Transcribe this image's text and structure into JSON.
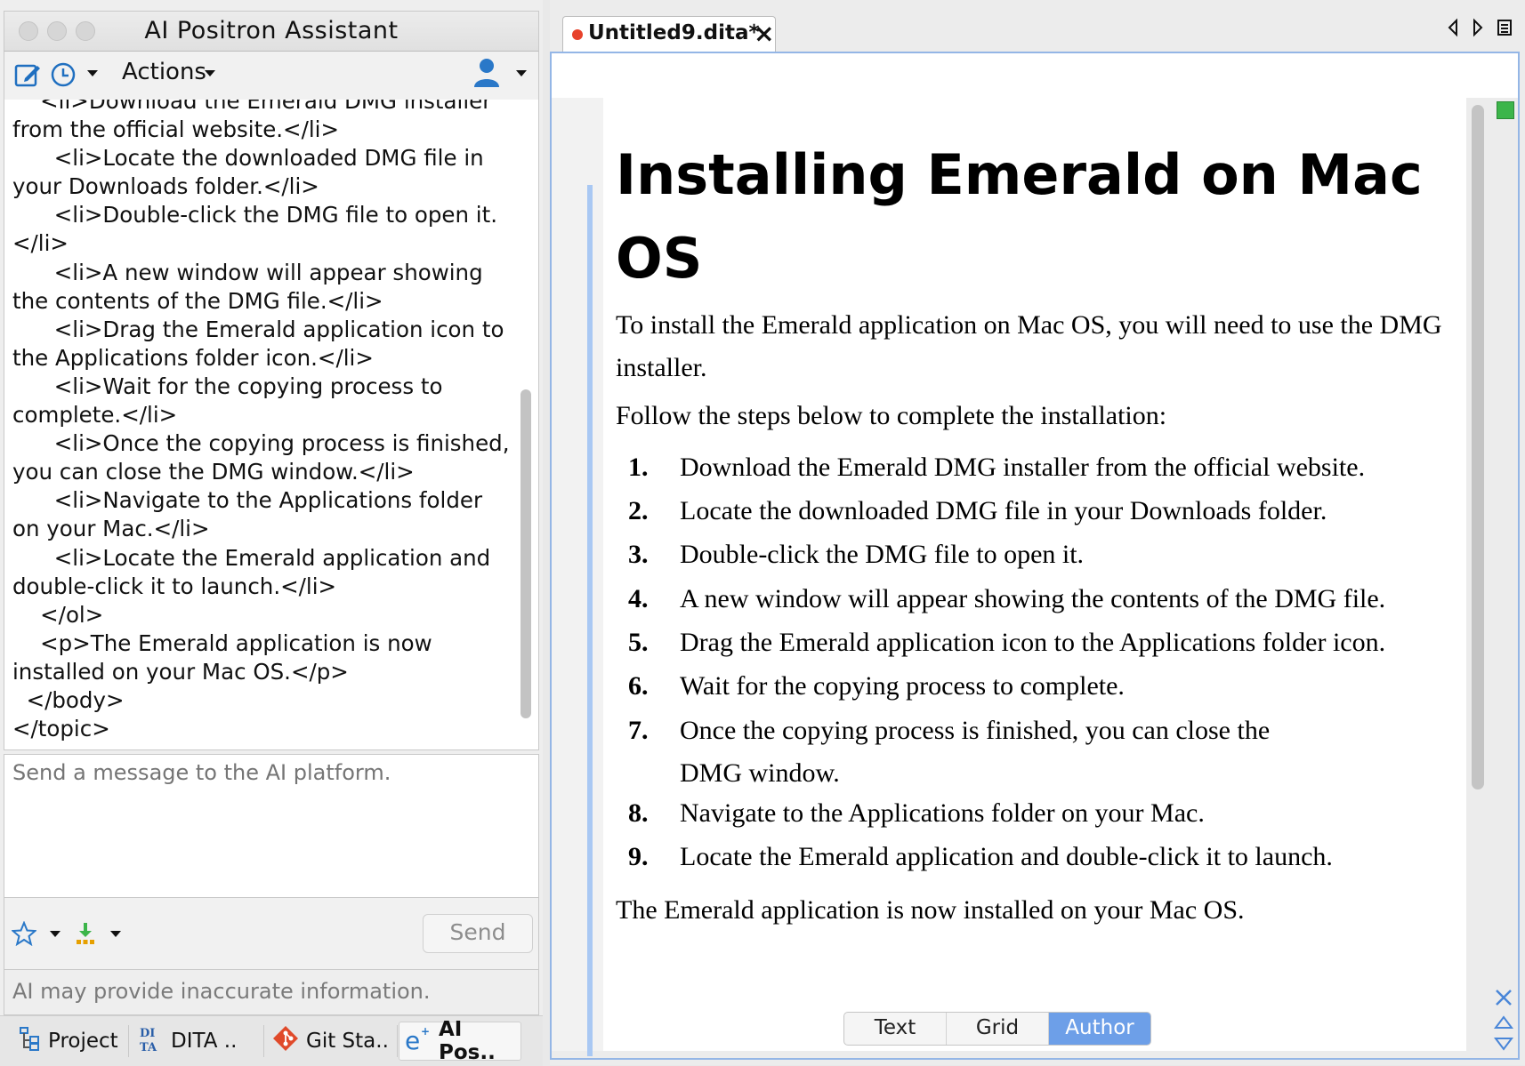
{
  "assistant": {
    "title": "AI Positron Assistant",
    "actions_label": "Actions",
    "chat_code": "    <li>Download the Emerald DMG installer from the official website.</li>\n      <li>Locate the downloaded DMG file in your Downloads folder.</li>\n      <li>Double-click the DMG file to open it.</li>\n      <li>A new window will appear showing the contents of the DMG file.</li>\n      <li>Drag the Emerald application icon to the Applications folder icon.</li>\n      <li>Wait for the copying process to complete.</li>\n      <li>Once the copying process is finished, you can close the DMG window.</li>\n      <li>Navigate to the Applications folder on your Mac.</li>\n      <li>Locate the Emerald application and double-click it to launch.</li>\n    </ol>\n    <p>The Emerald application is now installed on your Mac OS.</p>\n  </body>\n</topic>",
    "input_placeholder": "Send a message to the AI platform.",
    "send_label": "Send",
    "disclaimer": "AI may provide inaccurate information."
  },
  "side_tabs": [
    {
      "label": "Project",
      "icon": "project-icon"
    },
    {
      "label": "DITA ..",
      "icon": "dita-icon"
    },
    {
      "label": "Git Sta..",
      "icon": "git-icon"
    },
    {
      "label": "AI Pos..",
      "icon": "ai-positron-icon"
    }
  ],
  "editor": {
    "tab_title": "Untitled9.dita*",
    "doc_title": "Installing Emerald on Mac OS",
    "intro": "To install the Emerald application on Mac OS, you will need to use the DMG installer.",
    "follow": "Follow the steps below to complete the installation:",
    "steps": [
      "Download the Emerald DMG installer from the official website.",
      "Locate the downloaded DMG file in your Downloads folder.",
      "Double-click the DMG file to open it.",
      "A new window will appear showing the contents of the DMG file.",
      "Drag the Emerald application icon to the Applications folder icon.",
      "Wait for the copying process to complete.",
      "Once the copying process is finished, you can close the DMG window.",
      "Navigate to the Applications folder on your Mac.",
      "Locate the Emerald application and double-click it to launch."
    ],
    "step_numbers": [
      "1.",
      "2.",
      "3.",
      "4.",
      "5.",
      "6.",
      "7.",
      "8.",
      "9."
    ],
    "outro": "The Emerald application is now installed on your Mac OS.",
    "modes": [
      "Text",
      "Grid",
      "Author"
    ],
    "active_mode": "Author"
  },
  "colors": {
    "accent": "#6d9fe8",
    "modified_dot": "#e7422b",
    "valid_marker": "#3cb54a"
  }
}
